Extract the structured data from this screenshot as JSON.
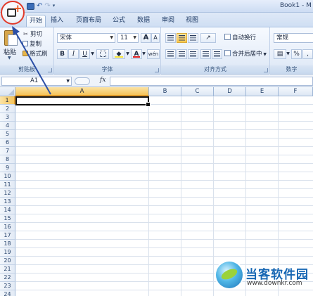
{
  "window": {
    "title": "Book1 - M"
  },
  "quick_access": {
    "save_icon": "save-icon",
    "undo_icon": "undo-icon",
    "redo_icon": "redo-icon",
    "separator": "|",
    "dropdown": "▾"
  },
  "tabs": [
    {
      "label": "开始",
      "active": true
    },
    {
      "label": "插入"
    },
    {
      "label": "页面布局"
    },
    {
      "label": "公式"
    },
    {
      "label": "数据"
    },
    {
      "label": "审阅"
    },
    {
      "label": "视图"
    }
  ],
  "clipboard": {
    "paste_label": "粘贴",
    "cut_label": "剪切",
    "copy_label": "复制",
    "format_painter_label": "格式刷",
    "group_label": "剪贴板"
  },
  "font": {
    "font_name": "宋体",
    "font_size": "11",
    "grow": "A",
    "shrink": "A",
    "bold": "B",
    "italic": "I",
    "underline": "U",
    "font_color_glyph": "A",
    "phonetic": "wén",
    "group_label": "字体"
  },
  "alignment": {
    "wrap_text_label": "自动换行",
    "merge_center_label": "合并后居中",
    "group_label": "对齐方式"
  },
  "number": {
    "format": "常规",
    "percent": "%",
    "comma": ",",
    "group_label": "数字"
  },
  "formula_bar": {
    "name_box": "A1",
    "fx_label": "fx",
    "formula": ""
  },
  "sheet": {
    "columns": [
      "A",
      "B",
      "C",
      "D",
      "E",
      "F"
    ],
    "selected_column": "A",
    "rows": [
      "1",
      "2",
      "3",
      "4",
      "5",
      "6",
      "7",
      "8",
      "9",
      "10",
      "11",
      "12",
      "13",
      "14",
      "15",
      "16",
      "17",
      "18",
      "19",
      "20",
      "21",
      "22",
      "23",
      "24"
    ],
    "selected_row": "1",
    "active_cell": "A1"
  },
  "watermark": {
    "name": "当客软件园",
    "url": "www.downkr.com"
  },
  "colors": {
    "accent": "#e23a2a",
    "selected_header": "#f5c45a",
    "ribbon": "#dbe6f5",
    "annotation_arrow": "#2b4fa6"
  }
}
